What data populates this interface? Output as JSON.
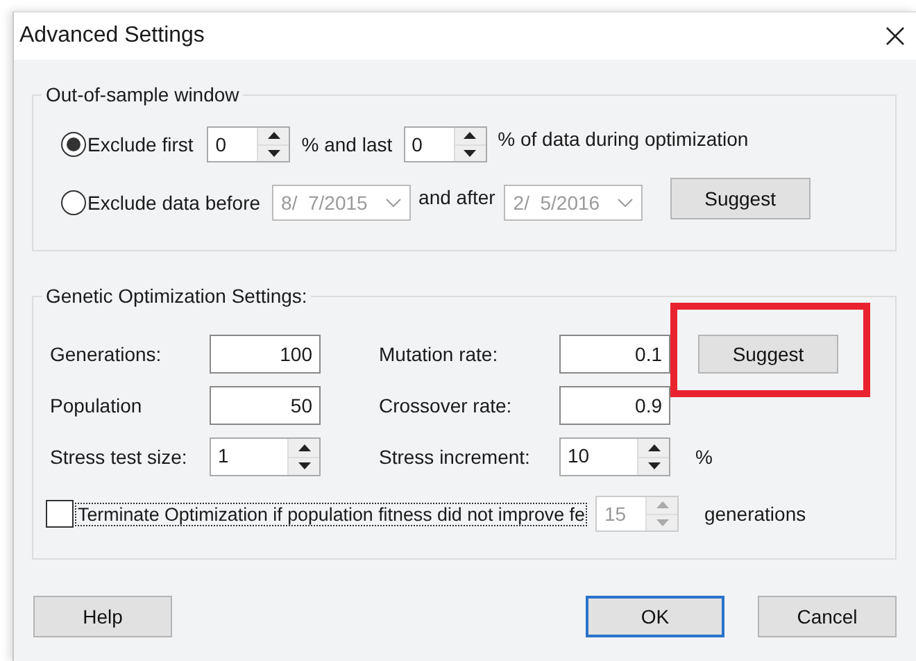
{
  "window": {
    "title": "Advanced Settings"
  },
  "out_of_sample": {
    "title": "Out-of-sample window",
    "options": [
      {
        "kind": "percent",
        "label": "Exclude first",
        "selected": true,
        "first_value": "0",
        "between": "% and last",
        "last_value": "0",
        "after": "% of data during optimization"
      },
      {
        "kind": "dates",
        "label": "Exclude data before",
        "selected": false,
        "from_date": "8/  7/2015",
        "between": "and after",
        "to_date": "2/  5/2016"
      }
    ],
    "suggest_button": "Suggest"
  },
  "genetic": {
    "title": "Genetic Optimization Settings:",
    "fields": [
      {
        "kind": "number",
        "label": "Generations:",
        "value": "100"
      },
      {
        "kind": "number",
        "label": "Mutation rate:",
        "value": "0.1"
      },
      {
        "kind": "number",
        "label": "Population",
        "value": "50"
      },
      {
        "kind": "number",
        "label": "Crossover rate:",
        "value": "0.9"
      },
      {
        "kind": "spin",
        "label": "Stress test size:",
        "value": "1"
      },
      {
        "kind": "spin",
        "label": "Stress increment:",
        "value": "10",
        "unit": "%"
      }
    ],
    "suggest_button": "Suggest",
    "terminate": {
      "checked": false,
      "label": "Terminate Optimization if population fitness did not improve fe",
      "value": "15",
      "disabled": true,
      "unit": "generations"
    }
  },
  "buttons": [
    {
      "label": "Help",
      "default": false
    },
    {
      "label": "OK",
      "default": true
    },
    {
      "label": "Cancel",
      "default": false
    }
  ]
}
